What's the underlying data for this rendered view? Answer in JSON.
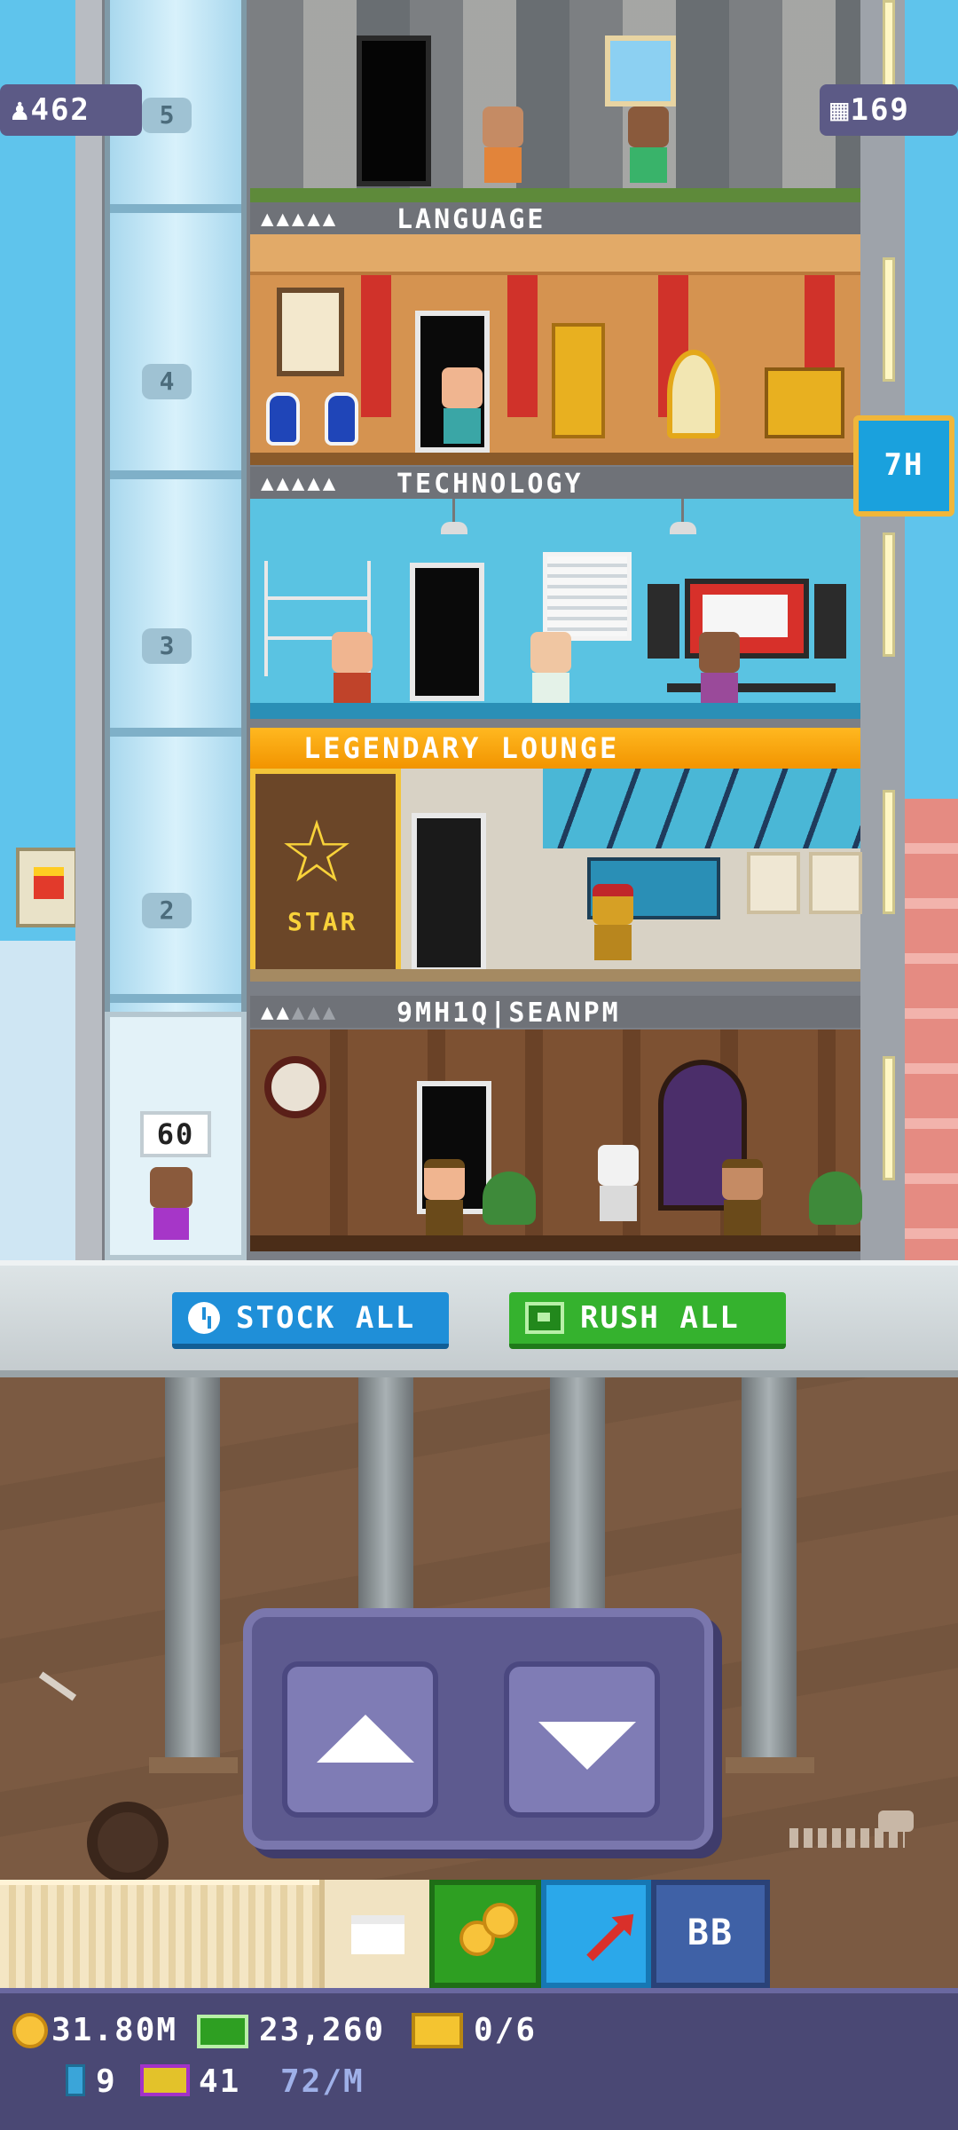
{
  "hud": {
    "population": "462",
    "floors": "169",
    "timer": "7H"
  },
  "elevator": {
    "rider_count": "60",
    "floor_numbers": [
      "5",
      "4",
      "3",
      "2"
    ]
  },
  "floors": {
    "language": {
      "name": "LANGUAGE",
      "stars_filled": "▲▲▲▲▲",
      "stars_empty": ""
    },
    "technology": {
      "name": "TECHNOLOGY",
      "stars_filled": "▲▲▲▲▲",
      "stars_empty": ""
    },
    "lounge": {
      "name": "LEGENDARY LOUNGE",
      "sign": "STAR"
    },
    "lobby": {
      "name": "9MH1Q|SEANPM",
      "stars_filled": "▲▲",
      "stars_empty": "▲▲▲"
    }
  },
  "actions": {
    "stock_all": "STOCK ALL",
    "rush_all": "RUSH ALL"
  },
  "toolbar": {
    "bb_label": "BB"
  },
  "status": {
    "coins": "31.80M",
    "cash": "23,260",
    "tickets": "0/6",
    "bux": "9",
    "vip": "41",
    "rate": "72/M"
  },
  "icons": [
    "population-icon",
    "building-icon",
    "clock-icon",
    "cash-icon",
    "box-icon",
    "coins-icon",
    "rocket-icon",
    "coin-icon",
    "ticket-icon",
    "bux-icon",
    "bitizen-icon",
    "up-arrow-icon",
    "down-arrow-icon"
  ],
  "colors": {
    "sky": "#5fc4ec",
    "stock_button": "#1f8fd8",
    "rush_button": "#35b22e",
    "lounge_banner": "#f29400",
    "panel": "#5d5a8f",
    "status_bar": "#4a4874"
  }
}
